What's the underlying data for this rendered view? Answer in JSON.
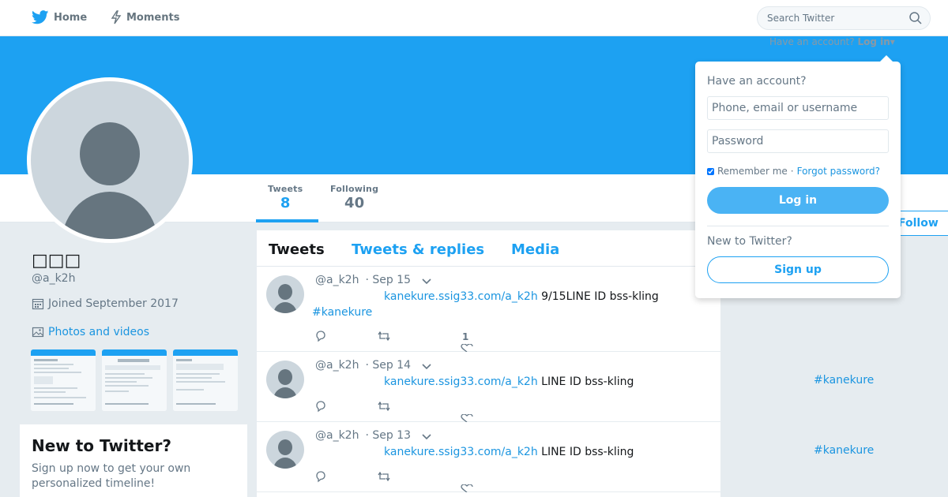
{
  "nav": {
    "home_label": "Home",
    "moments_label": "Moments",
    "search_placeholder": "Search Twitter"
  },
  "header": {
    "have_account_text": "Have an account?",
    "login_toggle_label": "Log in"
  },
  "profile": {
    "name": "□□□",
    "handle": "@a_k2h",
    "joined": "Joined September 2017",
    "photos_label": "Photos and videos",
    "follow_label": "Follow",
    "stats": [
      {
        "label": "Tweets",
        "value": "8"
      },
      {
        "label": "Following",
        "value": "40"
      }
    ]
  },
  "new_to_twitter": {
    "title": "New to Twitter?",
    "text": "Sign up now to get your own personalized timeline!"
  },
  "timeline": {
    "tabs": [
      "Tweets",
      "Tweets & replies",
      "Media"
    ],
    "tweets": [
      {
        "handle": "@a_k2h",
        "date": "· Sep 15",
        "link": "kanekure.ssig33.com/a_k2h",
        "text": " 9/15LINE ID bss-kling",
        "hashtag": "#kanekure",
        "likes": "1"
      },
      {
        "handle": "@a_k2h",
        "date": "· Sep 14",
        "link": "kanekure.ssig33.com/a_k2h",
        "text": " LINE ID bss-kling",
        "hashtag": "#kanekure",
        "likes": ""
      },
      {
        "handle": "@a_k2h",
        "date": "· Sep 13",
        "link": "kanekure.ssig33.com/a_k2h",
        "text": " LINE ID bss-kling",
        "hashtag": "#kanekure",
        "likes": ""
      }
    ]
  },
  "login_dropdown": {
    "title": "Have an account?",
    "username_placeholder": "Phone, email or username",
    "password_placeholder": "Password",
    "remember_label": "Remember me",
    "separator": "·",
    "forgot_label": "Forgot password?",
    "login_button": "Log in",
    "new_to_twitter": "New to Twitter?",
    "signup_button": "Sign up"
  },
  "colors": {
    "accent": "#1da1f2",
    "link": "#1b95e0",
    "background": "#e6ecf0"
  }
}
